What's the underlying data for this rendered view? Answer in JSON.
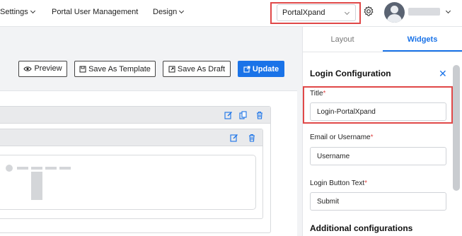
{
  "nav": {
    "settings": "Settings",
    "portal_user_management": "Portal User Management",
    "design": "Design"
  },
  "portal_select": {
    "value": "PortalXpand"
  },
  "toolbar": {
    "preview": "Preview",
    "save_template": "Save As Template",
    "save_draft": "Save As Draft",
    "update": "Update"
  },
  "right_panel": {
    "tabs": [
      "Layout",
      "Widgets"
    ],
    "active_tab": "Widgets",
    "config_title": "Login Configuration",
    "fields": [
      {
        "label": "Title",
        "required": "*",
        "value": "Login-PortalXpand"
      },
      {
        "label": "Email or Username",
        "required": "*",
        "value": "Username"
      },
      {
        "label": "Login Button Text",
        "required": "*",
        "value": "Submit"
      }
    ],
    "additional": "Additional configurations"
  },
  "colors": {
    "accent": "#1a73e8",
    "highlight": "#e04848",
    "required": "#e04848"
  },
  "icons": [
    "chevron-down-icon",
    "gear-icon",
    "eye-icon",
    "save-icon",
    "external-link-icon",
    "edit-icon",
    "copy-icon",
    "trash-icon",
    "close-icon"
  ]
}
